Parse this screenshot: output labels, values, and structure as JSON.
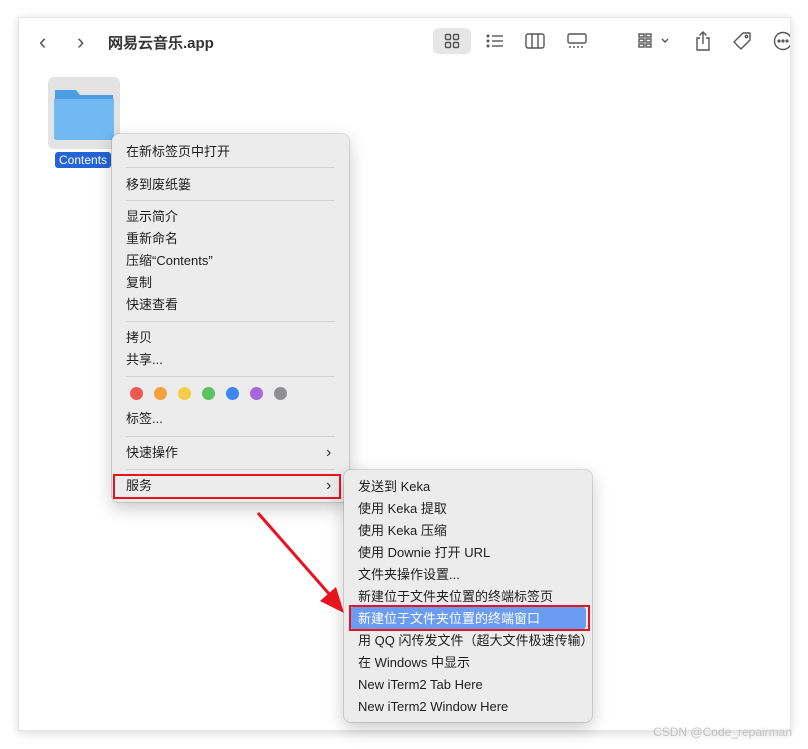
{
  "window": {
    "title": "网易云音乐.app",
    "back_glyph": "‹",
    "forward_glyph": "›"
  },
  "toolbar": {
    "icons": [
      "grid-view-icon",
      "list-view-icon",
      "column-view-icon",
      "gallery-view-icon",
      "group-icon",
      "share-icon",
      "tag-icon",
      "more-icon"
    ]
  },
  "folder": {
    "name": "Contents",
    "color": "#6cb4ef"
  },
  "context_menu": {
    "open_in_tab": "在新标签页中打开",
    "move_to_trash": "移到废纸篓",
    "get_info": "显示简介",
    "rename": "重新命名",
    "compress": "压缩“Contents”",
    "duplicate": "复制",
    "quick_look": "快速查看",
    "copy": "拷贝",
    "share": "共享...",
    "tags": "标签...",
    "quick_actions": "快速操作",
    "services": "服务",
    "chevron": "›",
    "tag_colors": [
      "#ec5b52",
      "#f5a03c",
      "#f6cd48",
      "#5dc160",
      "#3f86f0",
      "#a865dc",
      "#8e8e93"
    ]
  },
  "services_menu": {
    "items": [
      "发送到 Keka",
      "使用 Keka 提取",
      "使用 Keka 压缩",
      "使用 Downie 打开 URL",
      "文件夹操作设置...",
      "新建位于文件夹位置的终端标签页",
      "新建位于文件夹位置的终端窗口",
      "用 QQ 闪传发文件（超大文件极速传输）",
      "在 Windows 中显示",
      "New iTerm2 Tab Here",
      "New iTerm2 Window Here"
    ],
    "highlighted_index": 6
  },
  "annotation": {
    "color": "#e8131f"
  },
  "watermark": "CSDN @Code_repairman"
}
